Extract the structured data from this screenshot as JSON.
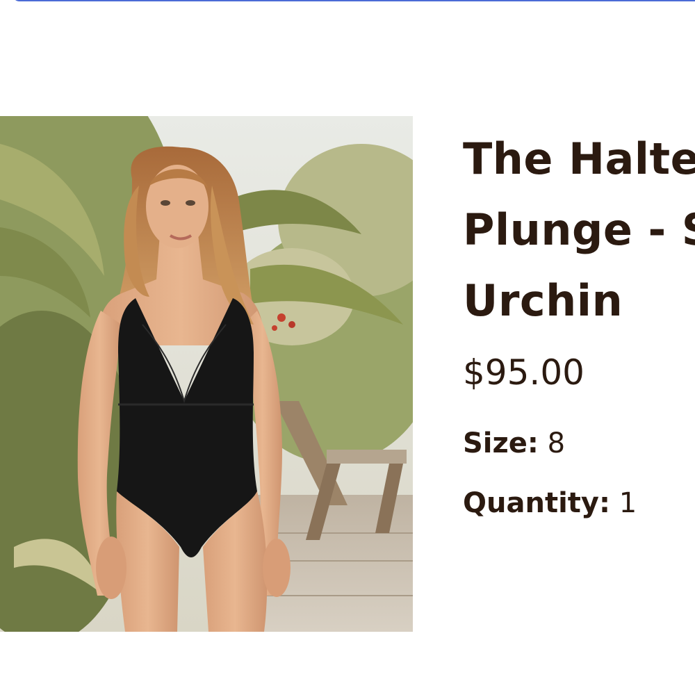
{
  "product": {
    "title": "The Halter Plunge - Sea Urchin",
    "title_visible": "The Halte\nPlunge - S\nUrchin",
    "price": "$95.00",
    "size_label": "Size:",
    "size_value": "8",
    "quantity_label": "Quantity:",
    "quantity_value": "1",
    "image_alt": "Model wearing a black halter plunge one-piece swimsuit among tropical plants"
  },
  "colors": {
    "text": "#2b1a10",
    "accent_border": "#4a6bd6",
    "swimsuit": "#161616"
  }
}
